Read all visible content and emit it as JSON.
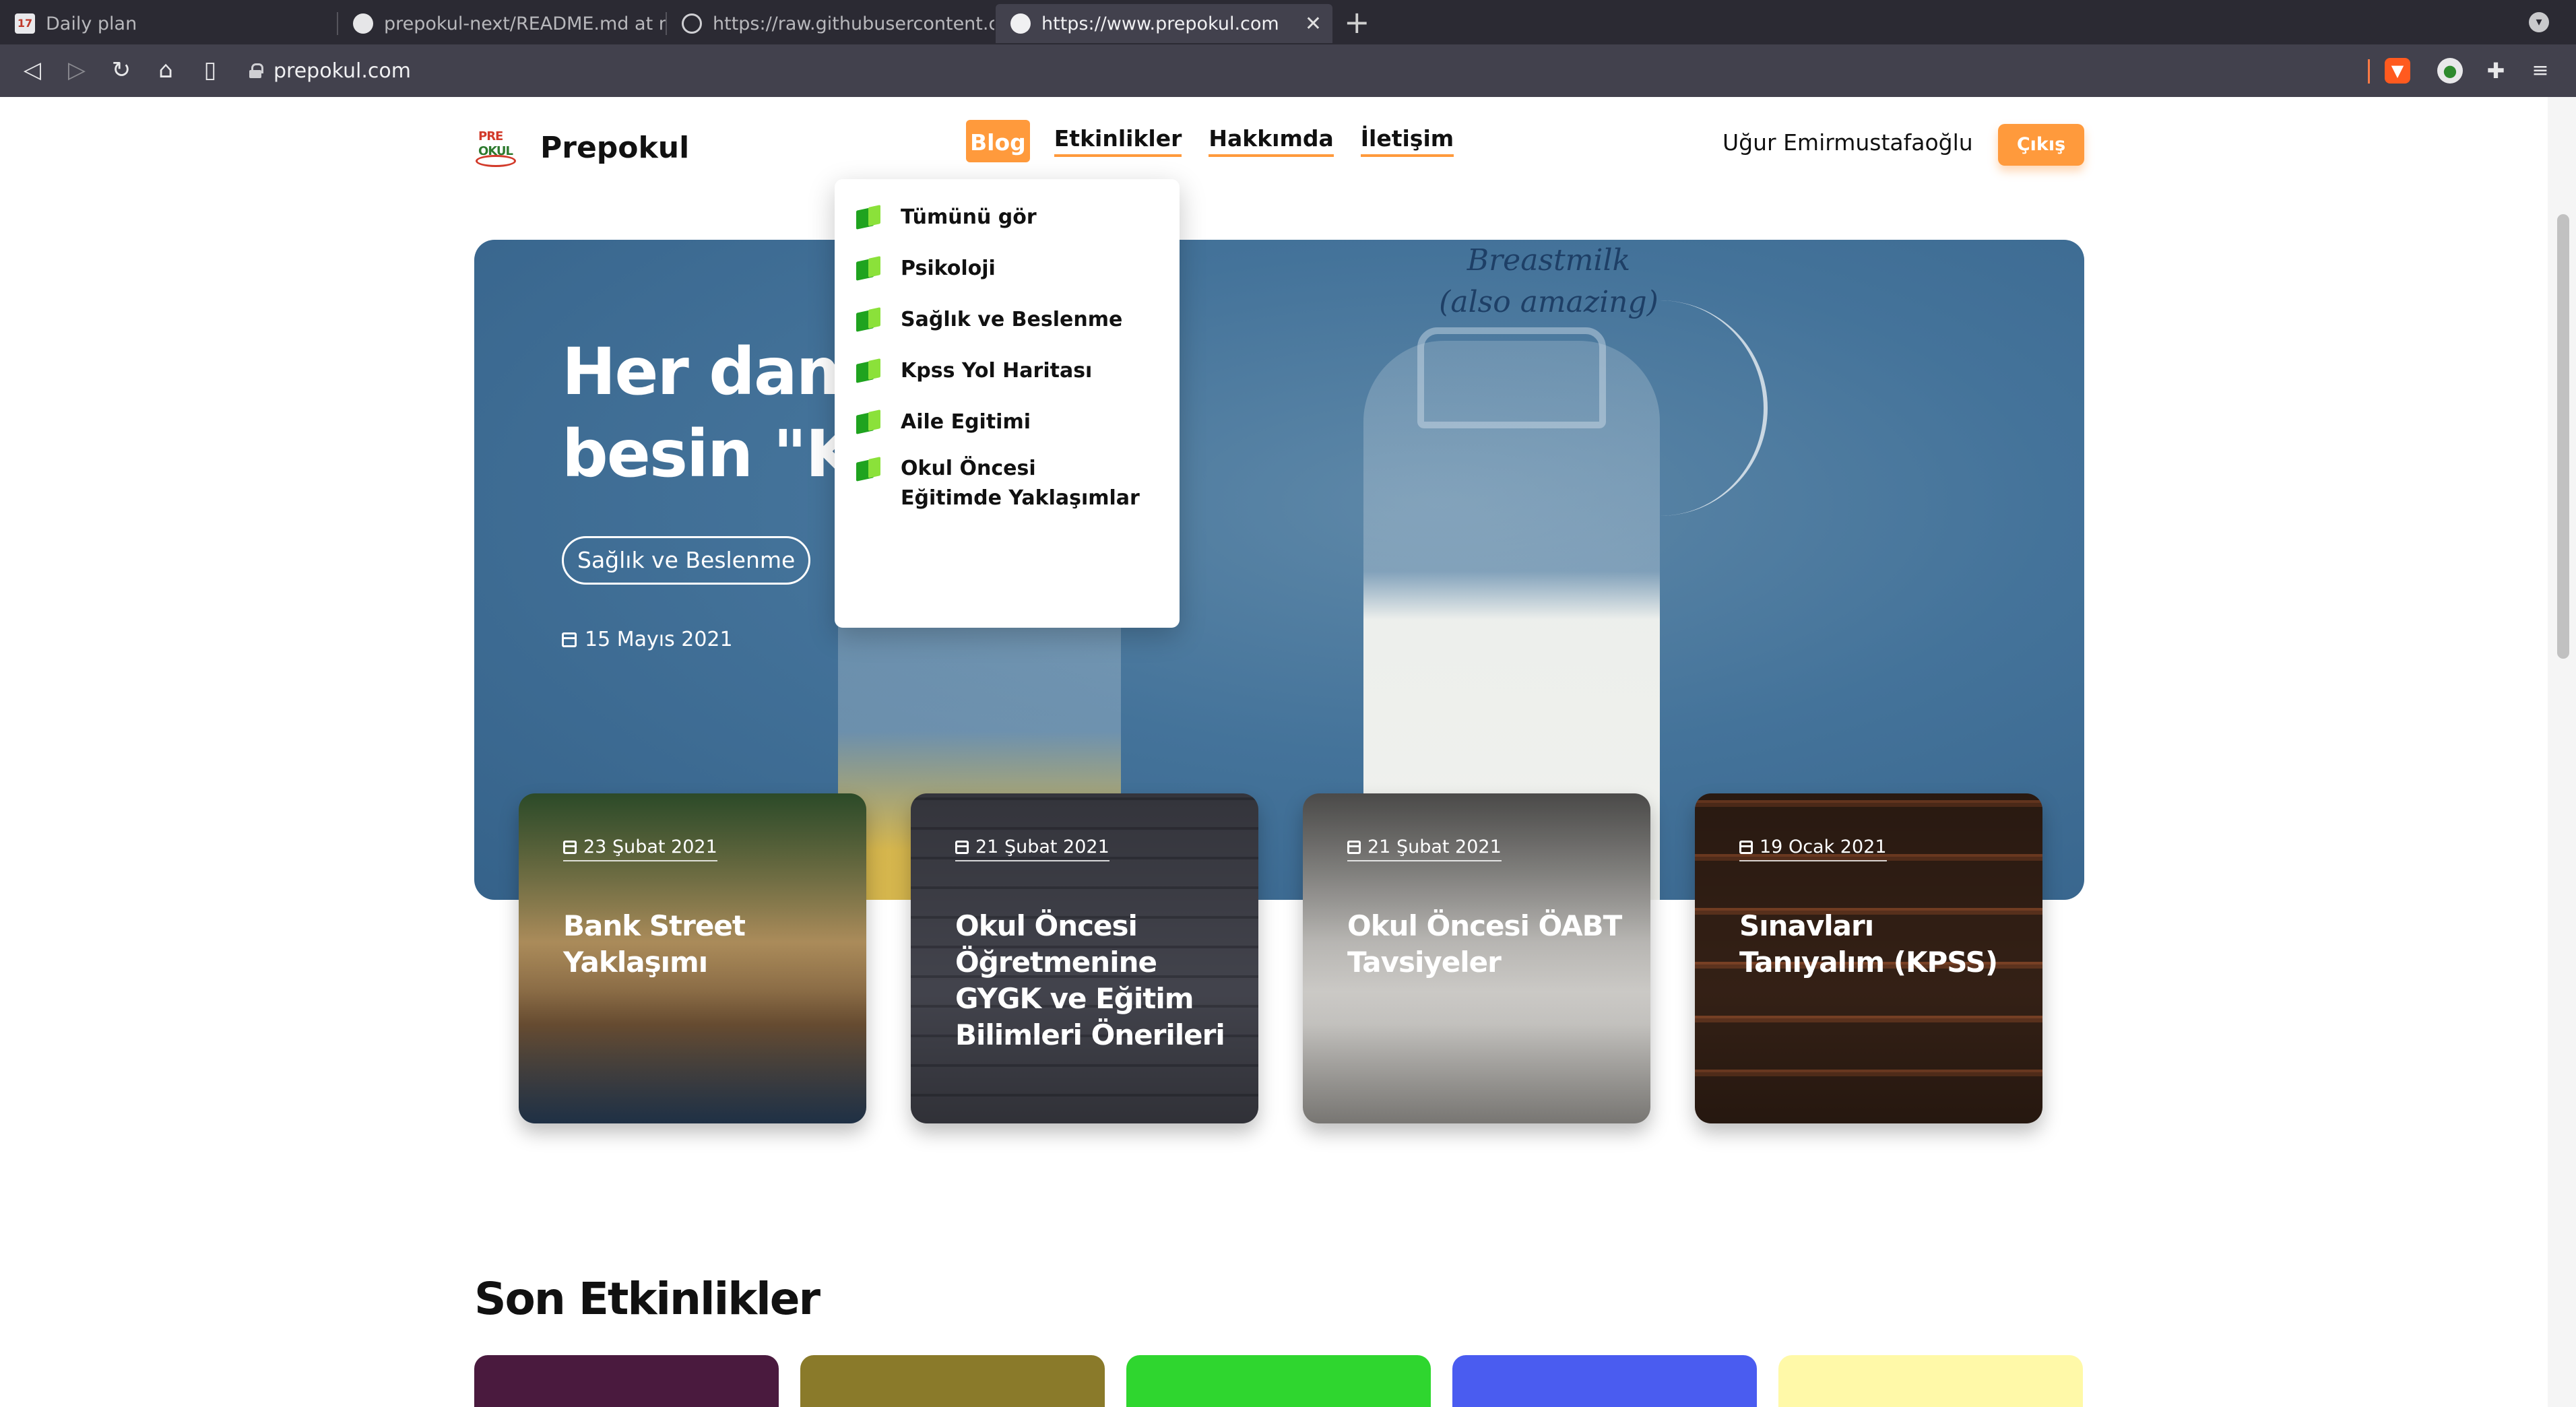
{
  "browser": {
    "tabs": [
      {
        "title": "Daily plan",
        "icon": "calendar-icon",
        "icon_text": "17"
      },
      {
        "title": "prepokul-next/README.md at m",
        "icon": "github-icon"
      },
      {
        "title": "https://raw.githubusercontent.c",
        "icon": "globe-icon"
      },
      {
        "title": "https://www.prepokul.com",
        "icon": "triangle-icon",
        "active": true
      }
    ],
    "close_symbol": "✕",
    "new_tab_symbol": "+",
    "url": "prepokul.com",
    "nav_icons": {
      "back": "◁",
      "forward": "▷",
      "reload": "↻",
      "home": "⌂",
      "bookmark": "▯"
    }
  },
  "site": {
    "brand": "Prepokul",
    "logo_text_top": "PRE",
    "logo_text_bottom": "OKUL",
    "nav": {
      "blog": "Blog",
      "events": "Etkinlikler",
      "about": "Hakkımda",
      "contact": "İletişim"
    },
    "user_name": "Uğur Emirmustafaoğlu",
    "logout_label": "Çıkış",
    "colors": {
      "accent": "#ff9a3c",
      "hero_bg": "#44739a"
    }
  },
  "dropdown": {
    "items": [
      "Tümünü gör",
      "Psikoloji",
      "Sağlık ve Beslenme",
      "Kpss Yol Haritası",
      "Aile Egitimi",
      "Okul Öncesi Eğitimde Yaklaşımlar"
    ]
  },
  "hero": {
    "title_line1": "Her damla bir",
    "title_line2": "besin \"Ka",
    "image_text": "Breastmilk (also amazing)",
    "tag": "Sağlık ve Beslenme",
    "date": "15 Mayıs 2021"
  },
  "cards": [
    {
      "date": "23 Şubat 2021",
      "title": "Bank Street Yaklaşımı"
    },
    {
      "date": "21 Şubat 2021",
      "title": "Okul Öncesi Öğretmenine GYGK ve Eğitim Bilimleri Önerileri"
    },
    {
      "date": "21 Şubat 2021",
      "title": "Okul Öncesi ÖABT Tavsiyeler"
    },
    {
      "date": "19 Ocak 2021",
      "title": "Sınavları Tanıyalım (KPSS)"
    }
  ],
  "section": {
    "title": "Son Etkinlikler"
  }
}
